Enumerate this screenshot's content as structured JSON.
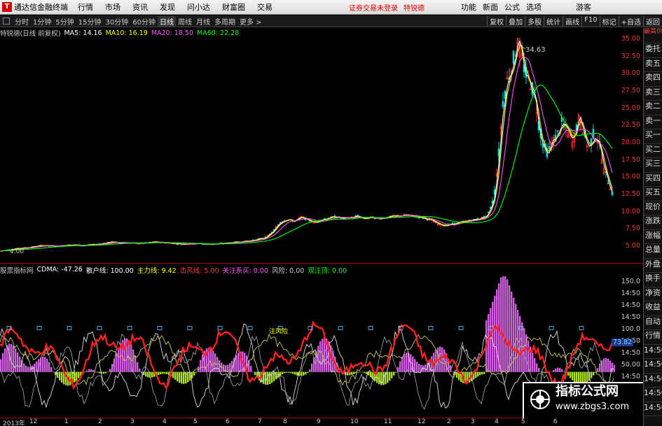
{
  "menubar": {
    "app_title": "通达信金融终端",
    "items": [
      "行情",
      "市场",
      "资讯",
      "发现",
      "问小达",
      "财富圈",
      "交易"
    ],
    "status_text": "证券交易未登录",
    "stock_name": "特锐德",
    "right_items": [
      "功能",
      "新面",
      "公式",
      "选项"
    ],
    "guest": "游客"
  },
  "toolbar": {
    "periods": [
      "分时",
      "1分钟",
      "5分钟",
      "15分钟",
      "30分钟",
      "60分钟",
      "日线",
      "周线",
      "月线",
      "多周期",
      "更多 >"
    ],
    "active_period": "日线",
    "right_buttons": [
      "复权",
      "叠加",
      "多股",
      "统计",
      "画线",
      "F10",
      "标记",
      "+自选",
      "返回"
    ]
  },
  "kline_info": {
    "title": "特锐德(日线 前复权)",
    "ma5": "MA5: 14.16",
    "ma10": "MA10: 16.19",
    "ma20": "MA20: 18.50",
    "ma60": "MA60: 22.28",
    "peak_label": "34.63",
    "low_label": "4.00",
    "colors": {
      "ma5": "#ffffff",
      "ma10": "#ffff00",
      "ma20": "#ff55ff",
      "ma60": "#00ff00"
    }
  },
  "indicator_info": {
    "name": "股票指标网",
    "cdma": "CDMA: -47.26",
    "sanhu": "散户线: 100.00",
    "zhuli": "主力线: 9.42",
    "qiangxian": "击风线: 5.00",
    "guanzhu": "关注系买: 0.00",
    "fengxian": "风险: 0.00",
    "guanzhu2": "观注顶: 0.00",
    "annotation": "注风险",
    "current_value": "73.82"
  },
  "y_axis_main": [
    "35.00",
    "32.50",
    "30.00",
    "27.50",
    "25.00",
    "22.50",
    "20.00",
    "17.50",
    "15.00",
    "12.50",
    "10.00",
    "7.50",
    "5.00"
  ],
  "y_axis_sub": [
    "150.0",
    "14:50",
    "14:50",
    "14:50",
    "100.0",
    "14:50",
    "14:50",
    "50.00",
    "14:50",
    "14:50"
  ],
  "x_axis": [
    "2013年",
    "12",
    "1",
    "2",
    "3",
    "4",
    "5",
    "6",
    "7",
    "8",
    "9",
    "10",
    "11",
    "12",
    "2",
    "3",
    "4",
    "5",
    "6"
  ],
  "sidetabs": [
    "委托",
    "卖五",
    "卖四",
    "卖三",
    "卖二",
    "卖一",
    "买一",
    "买二",
    "买三",
    "买四",
    "买五",
    "现价",
    "涨跌",
    "涨幅",
    "总量",
    "外盘",
    "换手",
    "净资",
    "收益",
    "自动",
    "行情",
    "14:50",
    "14:50",
    "14:50",
    "14:50",
    "14:50"
  ],
  "sidetab_top": "最高价",
  "watermark": {
    "line1": "指标公式网",
    "line2": "www.zbgs3.com"
  },
  "price_path": [
    [
      0,
      4.3
    ],
    [
      20,
      4.6
    ],
    [
      40,
      4.8
    ],
    [
      60,
      5.1
    ],
    [
      80,
      5.0
    ],
    [
      100,
      5.2
    ],
    [
      120,
      5.1
    ],
    [
      140,
      5.3
    ],
    [
      160,
      5.6
    ],
    [
      180,
      5.5
    ],
    [
      200,
      5.4
    ],
    [
      220,
      5.6
    ],
    [
      240,
      5.5
    ],
    [
      260,
      5.3
    ],
    [
      280,
      5.4
    ],
    [
      300,
      5.3
    ],
    [
      320,
      5.4
    ],
    [
      340,
      5.6
    ],
    [
      360,
      5.8
    ],
    [
      380,
      6.3
    ],
    [
      390,
      7.2
    ],
    [
      400,
      8.5
    ],
    [
      410,
      8.9
    ],
    [
      420,
      8.6
    ],
    [
      430,
      9.2
    ],
    [
      440,
      8.8
    ],
    [
      450,
      8.4
    ],
    [
      460,
      8.9
    ],
    [
      470,
      9.1
    ],
    [
      480,
      9.3
    ],
    [
      490,
      9.0
    ],
    [
      500,
      9.1
    ],
    [
      510,
      9.4
    ],
    [
      520,
      9.0
    ],
    [
      530,
      9.2
    ],
    [
      540,
      9.0
    ],
    [
      560,
      9.3
    ],
    [
      580,
      9.5
    ],
    [
      600,
      9.2
    ],
    [
      615,
      8.8
    ],
    [
      625,
      8.2
    ],
    [
      635,
      8.0
    ],
    [
      650,
      8.3
    ],
    [
      665,
      8.6
    ],
    [
      680,
      8.9
    ],
    [
      695,
      9.3
    ],
    [
      705,
      12.0
    ],
    [
      712,
      18.5
    ],
    [
      718,
      26.0
    ],
    [
      724,
      29.0
    ],
    [
      732,
      31.5
    ],
    [
      738,
      34.6
    ],
    [
      745,
      32.0
    ],
    [
      752,
      29.5
    ],
    [
      758,
      28.5
    ],
    [
      764,
      26.5
    ],
    [
      770,
      22.0
    ],
    [
      776,
      19.5
    ],
    [
      782,
      18.5
    ],
    [
      788,
      20.0
    ],
    [
      795,
      21.0
    ],
    [
      802,
      22.8
    ],
    [
      810,
      21.5
    ],
    [
      818,
      19.8
    ],
    [
      825,
      23.5
    ],
    [
      832,
      22.0
    ],
    [
      840,
      19.0
    ],
    [
      848,
      21.5
    ],
    [
      855,
      20.0
    ],
    [
      862,
      16.0
    ],
    [
      868,
      14.5
    ],
    [
      875,
      12.5
    ]
  ]
}
